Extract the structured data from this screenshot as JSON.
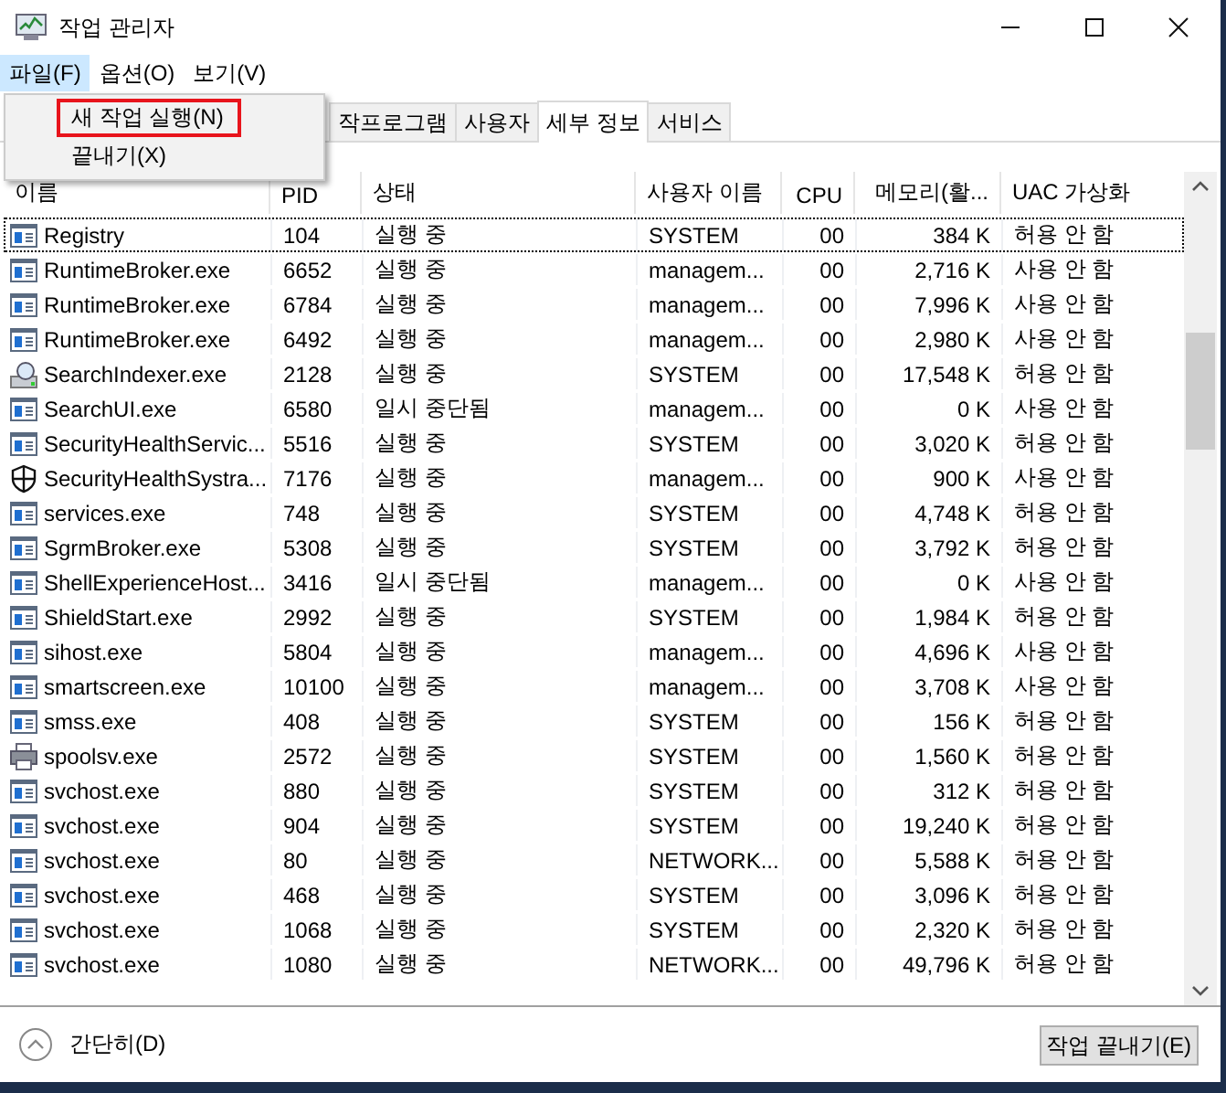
{
  "window": {
    "title": "작업 관리자"
  },
  "menu": [
    {
      "label": "파일(F)",
      "selected": true
    },
    {
      "label": "옵션(O)",
      "selected": false
    },
    {
      "label": "보기(V)",
      "selected": false
    }
  ],
  "file_menu": [
    {
      "label": "새 작업 실행(N)",
      "highlighted": true
    },
    {
      "label": "끝내기(X)",
      "highlighted": false
    }
  ],
  "tabs": [
    {
      "label": "작프로그램",
      "selected": false
    },
    {
      "label": "사용자",
      "selected": false
    },
    {
      "label": "세부 정보",
      "selected": true
    },
    {
      "label": "서비스",
      "selected": false
    }
  ],
  "table": {
    "columns": [
      "이름",
      "PID",
      "상태",
      "사용자 이름",
      "CPU",
      "메모리(활...",
      "UAC 가상화"
    ],
    "rows": [
      {
        "kind": "app",
        "focused": true,
        "cells": [
          "Registry",
          "104",
          "실행 중",
          "SYSTEM",
          "00",
          "384 K",
          "허용 안 함"
        ]
      },
      {
        "kind": "app",
        "focused": false,
        "cells": [
          "RuntimeBroker.exe",
          "6652",
          "실행 중",
          "managem...",
          "00",
          "2,716 K",
          "사용 안 함"
        ]
      },
      {
        "kind": "app",
        "focused": false,
        "cells": [
          "RuntimeBroker.exe",
          "6784",
          "실행 중",
          "managem...",
          "00",
          "7,996 K",
          "사용 안 함"
        ]
      },
      {
        "kind": "app",
        "focused": false,
        "cells": [
          "RuntimeBroker.exe",
          "6492",
          "실행 중",
          "managem...",
          "00",
          "2,980 K",
          "사용 안 함"
        ]
      },
      {
        "kind": "search",
        "focused": false,
        "cells": [
          "SearchIndexer.exe",
          "2128",
          "실행 중",
          "SYSTEM",
          "00",
          "17,548 K",
          "허용 안 함"
        ]
      },
      {
        "kind": "app",
        "focused": false,
        "cells": [
          "SearchUI.exe",
          "6580",
          "일시 중단됨",
          "managem...",
          "00",
          "0 K",
          "사용 안 함"
        ]
      },
      {
        "kind": "app",
        "focused": false,
        "cells": [
          "SecurityHealthServic...",
          "5516",
          "실행 중",
          "SYSTEM",
          "00",
          "3,020 K",
          "허용 안 함"
        ]
      },
      {
        "kind": "shield",
        "focused": false,
        "cells": [
          "SecurityHealthSystra...",
          "7176",
          "실행 중",
          "managem...",
          "00",
          "900 K",
          "사용 안 함"
        ]
      },
      {
        "kind": "app",
        "focused": false,
        "cells": [
          "services.exe",
          "748",
          "실행 중",
          "SYSTEM",
          "00",
          "4,748 K",
          "허용 안 함"
        ]
      },
      {
        "kind": "app",
        "focused": false,
        "cells": [
          "SgrmBroker.exe",
          "5308",
          "실행 중",
          "SYSTEM",
          "00",
          "3,792 K",
          "허용 안 함"
        ]
      },
      {
        "kind": "app",
        "focused": false,
        "cells": [
          "ShellExperienceHost...",
          "3416",
          "일시 중단됨",
          "managem...",
          "00",
          "0 K",
          "사용 안 함"
        ]
      },
      {
        "kind": "app",
        "focused": false,
        "cells": [
          "ShieldStart.exe",
          "2992",
          "실행 중",
          "SYSTEM",
          "00",
          "1,984 K",
          "허용 안 함"
        ]
      },
      {
        "kind": "app",
        "focused": false,
        "cells": [
          "sihost.exe",
          "5804",
          "실행 중",
          "managem...",
          "00",
          "4,696 K",
          "사용 안 함"
        ]
      },
      {
        "kind": "app",
        "focused": false,
        "cells": [
          "smartscreen.exe",
          "10100",
          "실행 중",
          "managem...",
          "00",
          "3,708 K",
          "사용 안 함"
        ]
      },
      {
        "kind": "app",
        "focused": false,
        "cells": [
          "smss.exe",
          "408",
          "실행 중",
          "SYSTEM",
          "00",
          "156 K",
          "허용 안 함"
        ]
      },
      {
        "kind": "printer",
        "focused": false,
        "cells": [
          "spoolsv.exe",
          "2572",
          "실행 중",
          "SYSTEM",
          "00",
          "1,560 K",
          "허용 안 함"
        ]
      },
      {
        "kind": "app",
        "focused": false,
        "cells": [
          "svchost.exe",
          "880",
          "실행 중",
          "SYSTEM",
          "00",
          "312 K",
          "허용 안 함"
        ]
      },
      {
        "kind": "app",
        "focused": false,
        "cells": [
          "svchost.exe",
          "904",
          "실행 중",
          "SYSTEM",
          "00",
          "19,240 K",
          "허용 안 함"
        ]
      },
      {
        "kind": "app",
        "focused": false,
        "cells": [
          "svchost.exe",
          "80",
          "실행 중",
          "NETWORK...",
          "00",
          "5,588 K",
          "허용 안 함"
        ]
      },
      {
        "kind": "app",
        "focused": false,
        "cells": [
          "svchost.exe",
          "468",
          "실행 중",
          "SYSTEM",
          "00",
          "3,096 K",
          "허용 안 함"
        ]
      },
      {
        "kind": "app",
        "focused": false,
        "cells": [
          "svchost.exe",
          "1068",
          "실행 중",
          "SYSTEM",
          "00",
          "2,320 K",
          "허용 안 함"
        ]
      },
      {
        "kind": "app",
        "focused": false,
        "cells": [
          "svchost.exe",
          "1080",
          "실행 중",
          "NETWORK...",
          "00",
          "49,796 K",
          "허용 안 함"
        ]
      }
    ]
  },
  "footer": {
    "toggle": "간단히(D)",
    "button": "작업 끝내기(E)"
  }
}
